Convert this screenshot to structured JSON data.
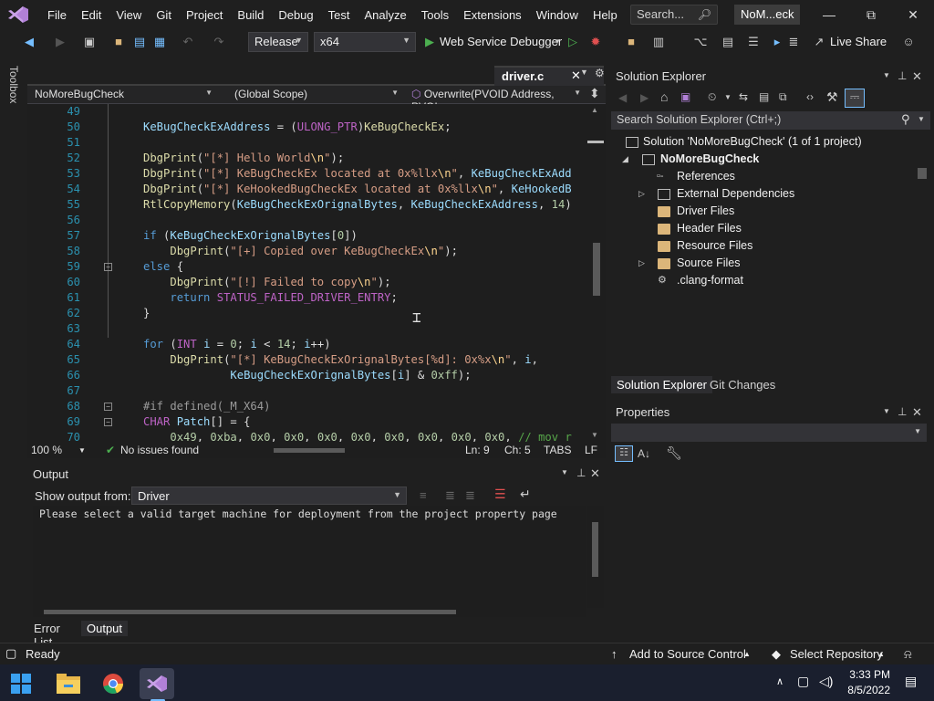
{
  "titlebar": {
    "menu": [
      "File",
      "Edit",
      "View",
      "Git",
      "Project",
      "Build",
      "Debug",
      "Test",
      "Analyze",
      "Tools",
      "Extensions",
      "Window",
      "Help"
    ],
    "search_label": "Search...",
    "solution_short": "NoM...eck"
  },
  "toolbar": {
    "configuration": "Release",
    "platform": "x64",
    "debugger": "Web Service Debugger",
    "live_share": "Live Share"
  },
  "side": {
    "toolbox": "Toolbox"
  },
  "editor": {
    "tab": "driver.c",
    "nav_project": "NoMoreBugCheck",
    "nav_scope": "(Global Scope)",
    "nav_member": "Overwrite(PVOID Address, PVOI",
    "zoom": "100 %",
    "issues": "No issues found",
    "ln": "Ln: 9",
    "ch": "Ch: 5",
    "indent": "TABS",
    "eol": "LF",
    "lines": [
      {
        "n": "49",
        "t": ""
      },
      {
        "n": "50",
        "t": "KeBugCheckExAddress = (ULONG_PTR)KeBugCheckEx;"
      },
      {
        "n": "51",
        "t": ""
      },
      {
        "n": "52",
        "t": "DbgPrint(\"[*] Hello World\\n\");"
      },
      {
        "n": "53",
        "t": "DbgPrint(\"[*] KeBugCheckEx located at 0x%llx\\n\", KeBugCheckExAdd"
      },
      {
        "n": "54",
        "t": "DbgPrint(\"[*] KeHookedBugCheckEx located at 0x%llx\\n\", KeHookedB"
      },
      {
        "n": "55",
        "t": "RtlCopyMemory(KeBugCheckExOrignalBytes, KeBugCheckExAddress, 14)"
      },
      {
        "n": "56",
        "t": ""
      },
      {
        "n": "57",
        "t": "if (KeBugCheckExOrignalBytes[0])"
      },
      {
        "n": "58",
        "t": "    DbgPrint(\"[+] Copied over KeBugCheckEx\\n\");"
      },
      {
        "n": "59",
        "t": "else {"
      },
      {
        "n": "60",
        "t": "    DbgPrint(\"[!] Failed to copy\\n\");"
      },
      {
        "n": "61",
        "t": "    return STATUS_FAILED_DRIVER_ENTRY;"
      },
      {
        "n": "62",
        "t": "}"
      },
      {
        "n": "63",
        "t": ""
      },
      {
        "n": "64",
        "t": "for (INT i = 0; i < 14; i++)"
      },
      {
        "n": "65",
        "t": "    DbgPrint(\"[*] KeBugCheckExOrignalBytes[%d]: 0x%x\\n\", i,"
      },
      {
        "n": "66",
        "t": "             KeBugCheckExOrignalBytes[i] & 0xff);"
      },
      {
        "n": "67",
        "t": ""
      },
      {
        "n": "68",
        "t": "#if defined(_M_X64)"
      },
      {
        "n": "69",
        "t": "CHAR Patch[] = {"
      },
      {
        "n": "70",
        "t": "    0x49, 0xba, 0x0, 0x0, 0x0, 0x0, 0x0, 0x0, 0x0, 0x0, // mov r"
      }
    ]
  },
  "output": {
    "title": "Output",
    "show_from_label": "Show output from:",
    "source": "Driver",
    "message": "Please select a valid target machine for deployment from the project property page",
    "tab_errors": "Error List",
    "tab_output": "Output"
  },
  "solution_explorer": {
    "title": "Solution Explorer",
    "search_placeholder": "Search Solution Explorer (Ctrl+;)",
    "solution": "Solution 'NoMoreBugCheck' (1 of 1 project)",
    "project": "NoMoreBugCheck",
    "items": [
      "References",
      "External Dependencies",
      "Driver Files",
      "Header Files",
      "Resource Files",
      "Source Files",
      ".clang-format"
    ],
    "tab_se": "Solution Explorer",
    "tab_git": "Git Changes"
  },
  "properties": {
    "title": "Properties"
  },
  "statusbar": {
    "ready": "Ready",
    "add_to_source": "Add to Source Control",
    "select_repo": "Select Repository"
  },
  "taskbar": {
    "time": "3:33 PM",
    "date": "8/5/2022"
  },
  "colors": {
    "accent": "#75beff",
    "vs_purple": "#b180d7",
    "folder": "#dcb67a"
  }
}
